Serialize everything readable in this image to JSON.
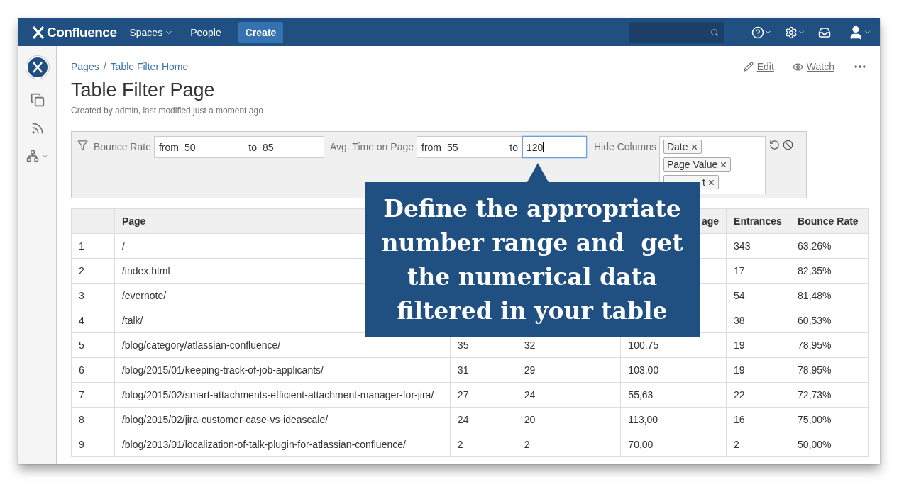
{
  "header": {
    "logo": "Confluence",
    "nav": [
      {
        "label": "Spaces",
        "kind": "dropdown"
      },
      {
        "label": "People",
        "kind": "link"
      }
    ],
    "create": "Create"
  },
  "breadcrumbs": [
    "Pages",
    "Table Filter Home"
  ],
  "breadcrumb_separator": "/",
  "actions": {
    "edit": "Edit",
    "watch": "Watch"
  },
  "title": "Table Filter Page",
  "byline": "Created by admin, last modified just a moment ago",
  "filter": {
    "ranges": [
      {
        "label": "Bounce Rate",
        "from_label": "from",
        "from": "50",
        "to_label": "to",
        "to": "85",
        "focused": false
      },
      {
        "label": "Avg. Time on Page",
        "from_label": "from",
        "from": "55",
        "to_label": "to",
        "to": "120",
        "focused": true
      }
    ],
    "hide_label": "Hide Columns",
    "tags": [
      "Date",
      "Page Value",
      "t"
    ]
  },
  "table": {
    "columns": [
      "",
      "Page",
      "",
      "",
      "age",
      "Entrances",
      "Bounce Rate"
    ],
    "rows": [
      [
        "1",
        "/",
        null,
        null,
        null,
        "343",
        "63,26%"
      ],
      [
        "2",
        "/index.html",
        null,
        null,
        null,
        "17",
        "82,35%"
      ],
      [
        "3",
        "/evernote/",
        null,
        null,
        null,
        "54",
        "81,48%"
      ],
      [
        "4",
        "/talk/",
        null,
        null,
        null,
        "38",
        "60,53%"
      ],
      [
        "5",
        "/blog/category/atlassian-confluence/",
        "35",
        "32",
        "100,75",
        "19",
        "78,95%"
      ],
      [
        "6",
        "/blog/2015/01/keeping-track-of-job-applicants/",
        "31",
        "29",
        "103,00",
        "19",
        "78,95%"
      ],
      [
        "7",
        "/blog/2015/02/smart-attachments-efficient-attachment-manager-for-jira/",
        "27",
        "24",
        "55,63",
        "22",
        "72,73%"
      ],
      [
        "8",
        "/blog/2015/02/jira-customer-case-vs-ideascale/",
        "24",
        "20",
        "113,00",
        "16",
        "75,00%"
      ],
      [
        "9",
        "/blog/2013/01/localization-of-talk-plugin-for-atlassian-confluence/",
        "2",
        "2",
        "70,00",
        "2",
        "50,00%"
      ]
    ]
  },
  "callout": [
    "Define the appropriate",
    "number range and  get",
    "the numerical data",
    "filtered in your table"
  ]
}
